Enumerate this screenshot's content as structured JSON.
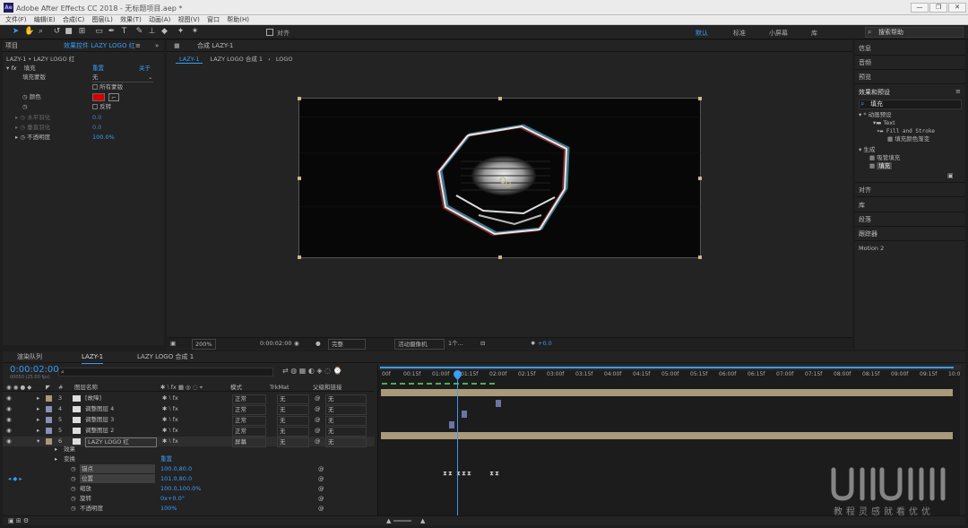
{
  "window": {
    "title": "Adobe After Effects CC 2018 - 无标题项目.aep *",
    "app_badge": "Ae",
    "controls": [
      "—",
      "❐",
      "✕"
    ]
  },
  "menu": [
    "文件(F)",
    "编辑(E)",
    "合成(C)",
    "图层(L)",
    "效果(T)",
    "动画(A)",
    "视图(V)",
    "窗口",
    "帮助(H)"
  ],
  "toolbar": {
    "snap_label": "对齐",
    "workspaces": [
      "默认",
      "标准",
      "小屏幕",
      "库"
    ],
    "active_workspace": "默认",
    "search_placeholder": "搜索帮助"
  },
  "effect_controls": {
    "tabs": [
      "项目",
      "效果控件 LAZY LOGO 红"
    ],
    "breadcrumb": "LAZY-1 • LAZY LOGO 红",
    "effect_name": "填充",
    "reset_label": "重置",
    "about_label": "关于",
    "props": [
      {
        "label": "填充蒙版",
        "value": "无"
      },
      {
        "label": "",
        "value": "所有蒙版"
      },
      {
        "label": "颜色",
        "value": ""
      },
      {
        "label": "",
        "value": "反转"
      },
      {
        "label": "水平羽化",
        "value": "0.0"
      },
      {
        "label": "垂直羽化",
        "value": "0.0"
      },
      {
        "label": "不透明度",
        "value": "100.0%"
      }
    ],
    "fill_color": "#d40000"
  },
  "composition": {
    "tab": "合成 LAZY-1",
    "breadcrumbs": [
      "LAZY-1",
      "LAZY LOGO 合成 1",
      "LOGO"
    ],
    "zoom": "200%",
    "timecode": "0:00:02:00",
    "quality": "完整",
    "camera": "活动摄像机",
    "views": "1个...",
    "exposure": "+0.0"
  },
  "right_panel": {
    "sections": [
      "信息",
      "音频",
      "预览",
      "效果和预设"
    ],
    "search_value": "填充",
    "tree": [
      "* 动画预设",
      "Text",
      "Fill and Stroke",
      "填充颜色渐变",
      "生成",
      "吸管填充",
      "填充"
    ],
    "lower_sections": [
      "对齐",
      "库",
      "段落",
      "跟踪器",
      "Motion 2"
    ]
  },
  "timeline": {
    "tabs": [
      "渲染队列",
      "LAZY-1",
      "LAZY LOGO 合成 1"
    ],
    "timecode": "0:00:02:00",
    "frame_info": "00050 (25.00 fps)",
    "columns": {
      "name": "图层名称",
      "mode": "模式",
      "trkmat": "TrkMat",
      "parent": "父级和链接"
    },
    "layers": [
      {
        "num": "3",
        "name": "[故障]",
        "mode": "正常",
        "trk": "无",
        "parent": "无"
      },
      {
        "num": "4",
        "name": "调整图层 4",
        "mode": "正常",
        "trk": "无",
        "parent": "无"
      },
      {
        "num": "5",
        "name": "调整图层 3",
        "mode": "正常",
        "trk": "无",
        "parent": "无"
      },
      {
        "num": "5",
        "name": "调整图层 2",
        "mode": "正常",
        "trk": "无",
        "parent": "无"
      },
      {
        "num": "6",
        "name": "LAZY LOGO 红",
        "mode": "屏幕",
        "trk": "无",
        "parent": "无"
      }
    ],
    "sub_rows": [
      {
        "label": "效果",
        "value": ""
      },
      {
        "label": "变换",
        "value": "重置"
      },
      {
        "label": "锚点",
        "value": "100.0,80.0"
      },
      {
        "label": "位置",
        "value": "101.0,80.0"
      },
      {
        "label": "缩放",
        "value": "100.0,100.0%"
      },
      {
        "label": "旋转",
        "value": "0x+0.0°"
      },
      {
        "label": "不透明度",
        "value": "100%"
      }
    ],
    "ruler": [
      "00f",
      "00:15f",
      "01:00f",
      "01:15f",
      "02:00f",
      "02:15f",
      "03:00f",
      "03:15f",
      "04:00f",
      "04:15f",
      "05:00f",
      "05:15f",
      "06:00f",
      "06:15f",
      "07:00f",
      "07:15f",
      "08:00f",
      "08:15f",
      "09:00f",
      "09:15f",
      "10:0"
    ],
    "playhead_fraction": 0.2
  },
  "watermark": {
    "logo": "UIIIUIII",
    "slogan": "教程灵感就看优优"
  },
  "colors": {
    "accent": "#3b9cf5",
    "layer_bar": "#a89a7a",
    "fill_red": "#d40000"
  }
}
